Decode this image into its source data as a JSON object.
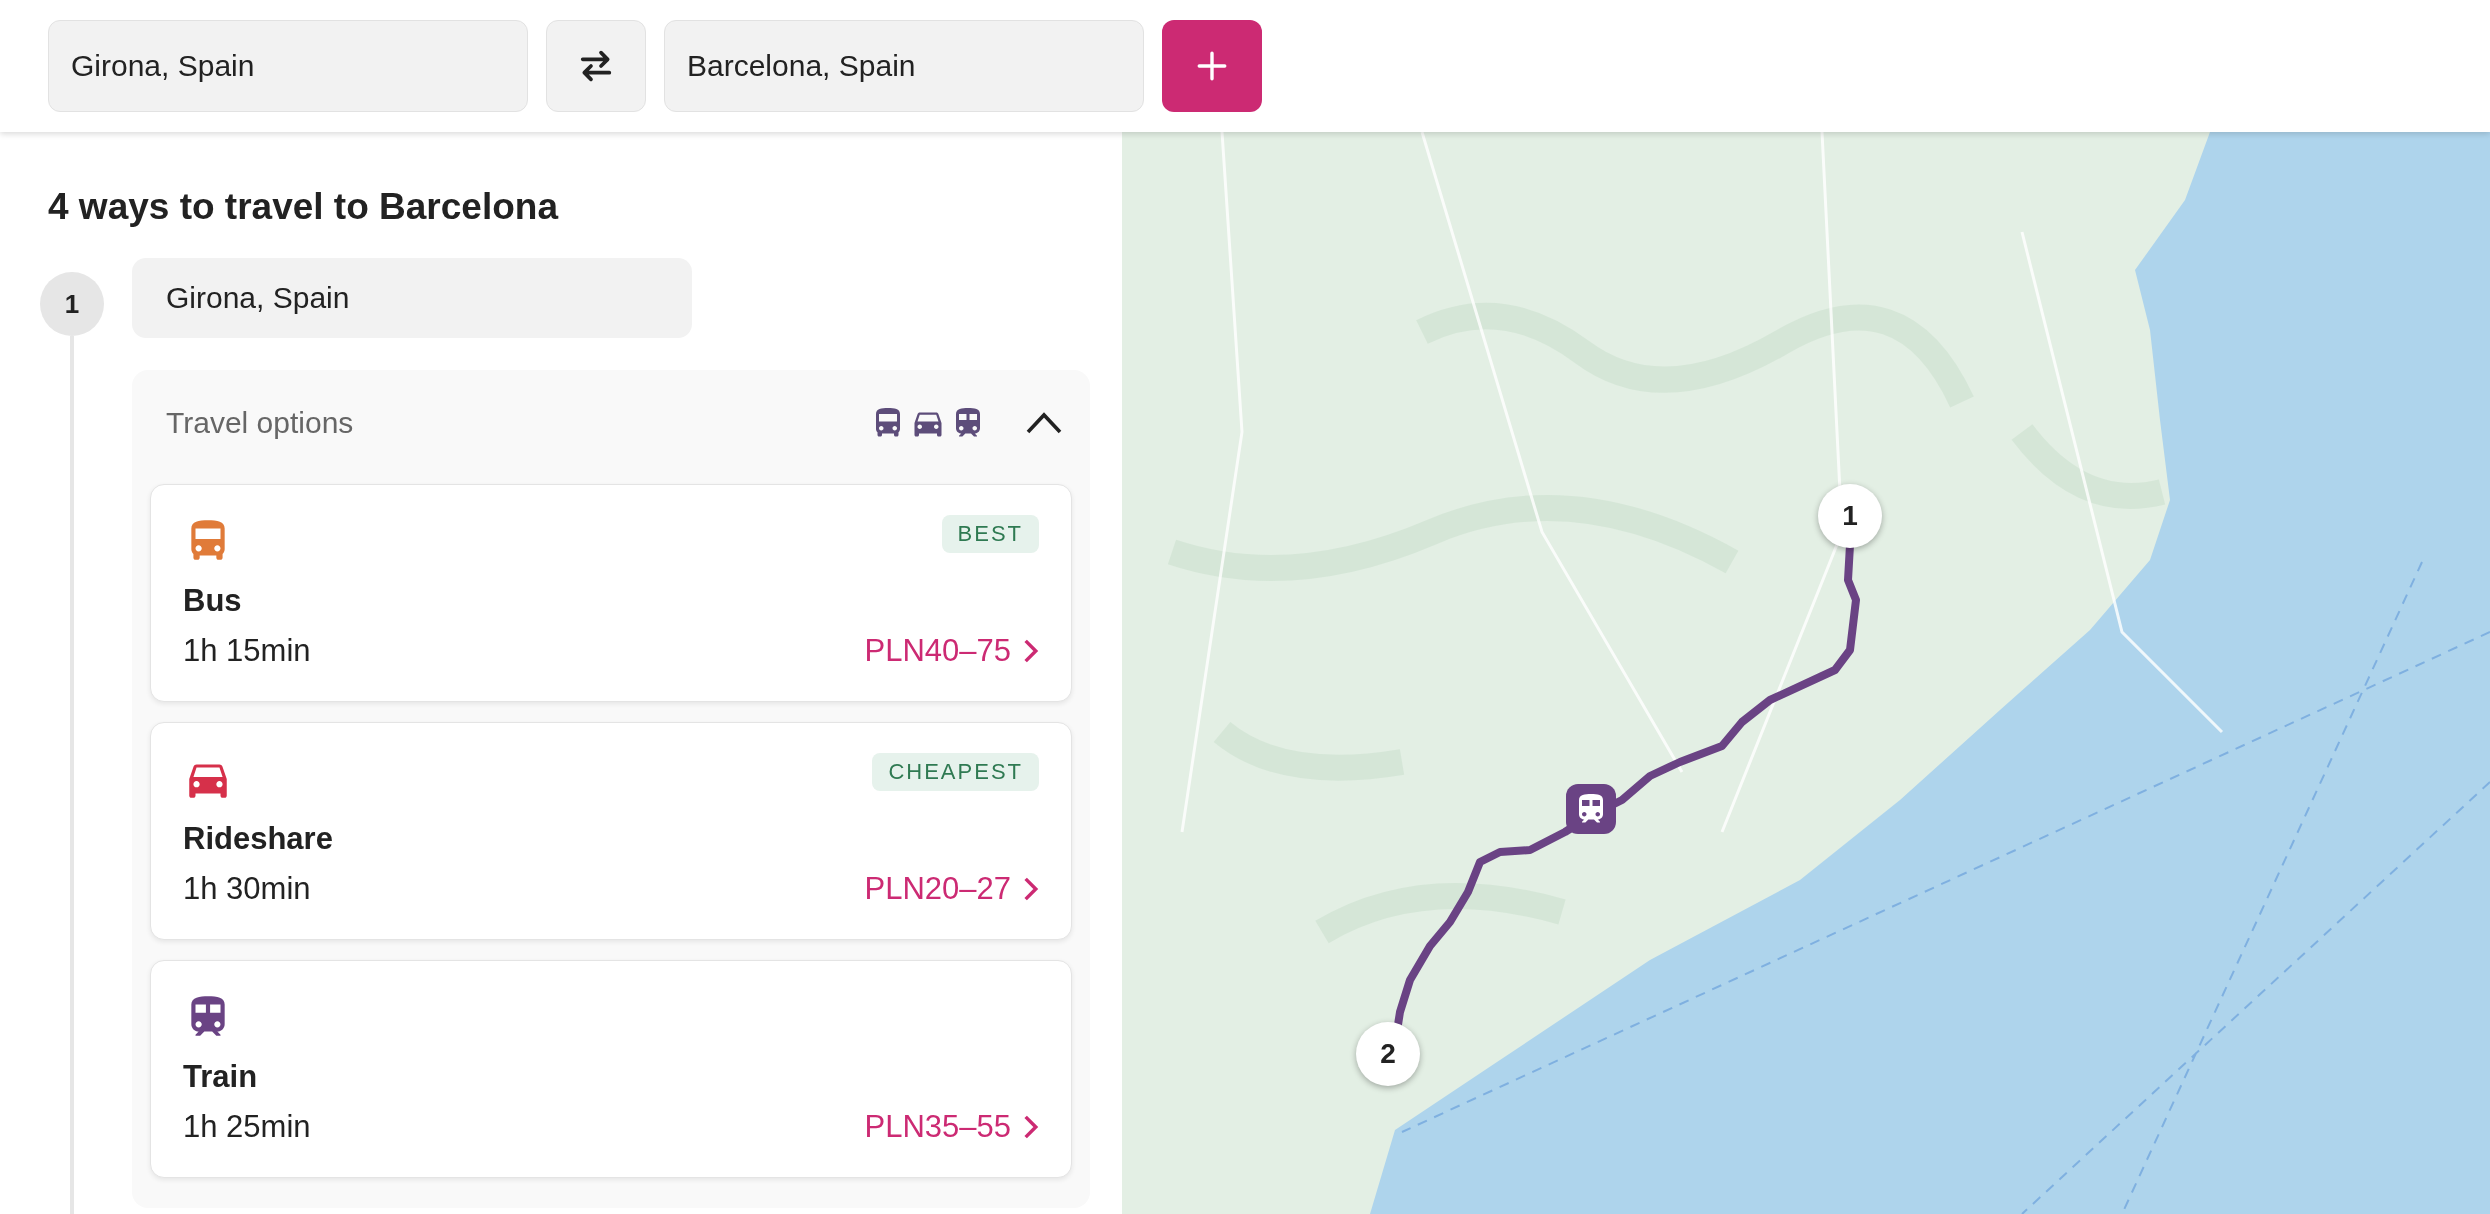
{
  "search": {
    "from": "Girona, Spain",
    "to": "Barcelona, Spain"
  },
  "heading": "4 ways to travel to Barcelona",
  "stop": {
    "number": "1",
    "place": "Girona, Spain"
  },
  "travel_options": {
    "title": "Travel options",
    "expanded": true,
    "options": [
      {
        "kind": "bus",
        "name": "Bus",
        "duration": "1h 15min",
        "price": "PLN40–75",
        "badge": "BEST"
      },
      {
        "kind": "car",
        "name": "Rideshare",
        "duration": "1h 30min",
        "price": "PLN20–27",
        "badge": "CHEAPEST"
      },
      {
        "kind": "train",
        "name": "Train",
        "duration": "1h 25min",
        "price": "PLN35–55"
      }
    ]
  },
  "map": {
    "markers": [
      {
        "label": "1"
      },
      {
        "label": "2"
      }
    ]
  }
}
